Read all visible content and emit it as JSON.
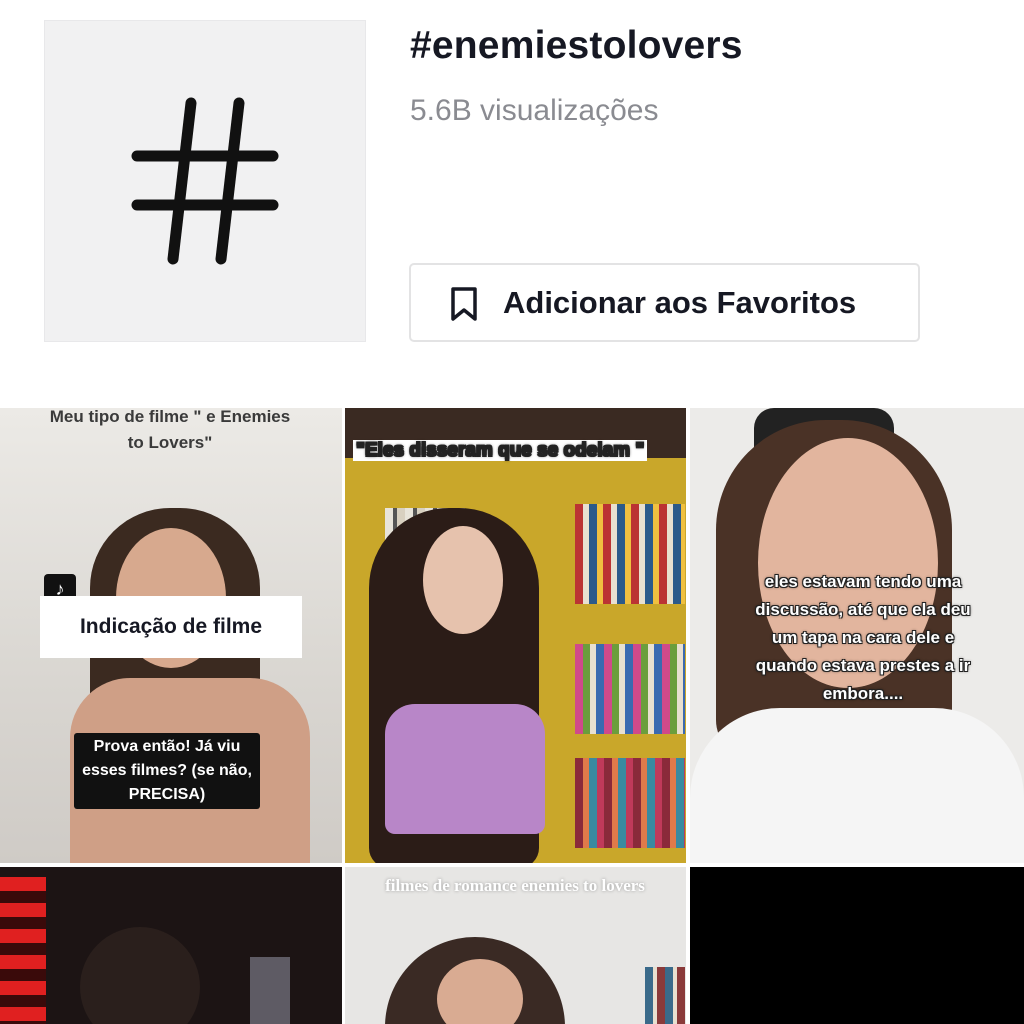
{
  "hashtag": {
    "title": "#enemiestolovers",
    "views": "5.6B visualizações",
    "tile_icon": "hashtag-icon",
    "favorite_button_label": "Adicionar aos Favoritos",
    "favorite_icon": "bookmark-icon"
  },
  "videos": [
    {
      "caption_top": "Meu tipo de filme \" e Enemies to Lovers\"",
      "app_logo": "tiktok-logo-icon",
      "banner": "Indicação de filme",
      "bubble": "Prova então! Já viu esses filmes? (se não, PRECISA)"
    },
    {
      "caption": "\"Eles disseram que se odeiam \""
    },
    {
      "caption": "eles estavam tendo uma discussão, até que ela deu um tapa na cara dele e quando estava prestes a ir embora...."
    },
    {
      "caption": ""
    },
    {
      "caption": "filmes de romance enemies to lovers"
    },
    {
      "caption": ""
    }
  ],
  "colors": {
    "text_primary": "#161823",
    "text_secondary": "#8a8b91",
    "tile_bg": "#f1f1f2",
    "border": "#e3e3e4"
  }
}
